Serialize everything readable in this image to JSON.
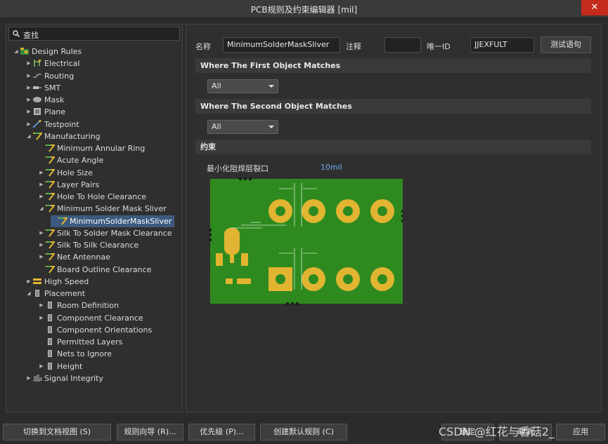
{
  "window": {
    "title": "PCB规则及约束编辑器 [mil]",
    "close_label": "✕"
  },
  "search": {
    "placeholder": "查找"
  },
  "tree": [
    {
      "label": "Design Rules",
      "icon": "design-rules-icon",
      "tw": "◢"
    },
    {
      "label": "Electrical",
      "icon": "electrical-icon",
      "tw": "▶"
    },
    {
      "label": "Routing",
      "icon": "routing-icon",
      "tw": "▶"
    },
    {
      "label": "SMT",
      "icon": "smt-icon",
      "tw": "▶"
    },
    {
      "label": "Mask",
      "icon": "mask-icon",
      "tw": "▶"
    },
    {
      "label": "Plane",
      "icon": "plane-icon",
      "tw": "▶"
    },
    {
      "label": "Testpoint",
      "icon": "testpoint-icon",
      "tw": "▶"
    },
    {
      "label": "Manufacturing",
      "icon": "manufacturing-icon",
      "tw": "◢"
    },
    {
      "label": "Minimum Annular Ring",
      "icon": "rule-icon",
      "tw": ""
    },
    {
      "label": "Acute Angle",
      "icon": "rule-icon",
      "tw": ""
    },
    {
      "label": "Hole Size",
      "icon": "rule-icon",
      "tw": "▶"
    },
    {
      "label": "Layer Pairs",
      "icon": "rule-icon",
      "tw": "▶"
    },
    {
      "label": "Hole To Hole Clearance",
      "icon": "rule-icon",
      "tw": "▶"
    },
    {
      "label": "Minimum Solder Mask Sliver",
      "icon": "rule-icon",
      "tw": "◢"
    },
    {
      "label": "MinimumSolderMaskSliver",
      "icon": "rule-icon",
      "tw": ""
    },
    {
      "label": "Silk To Solder Mask Clearance",
      "icon": "rule-icon",
      "tw": "▶"
    },
    {
      "label": "Silk To Silk Clearance",
      "icon": "rule-icon",
      "tw": "▶"
    },
    {
      "label": "Net Antennae",
      "icon": "rule-icon",
      "tw": "▶"
    },
    {
      "label": "Board Outline Clearance",
      "icon": "rule-icon",
      "tw": ""
    },
    {
      "label": "High Speed",
      "icon": "high-speed-icon",
      "tw": "▶"
    },
    {
      "label": "Placement",
      "icon": "placement-icon",
      "tw": "◢"
    },
    {
      "label": "Room Definition",
      "icon": "placement-rule-icon",
      "tw": "▶"
    },
    {
      "label": "Component Clearance",
      "icon": "placement-rule-icon",
      "tw": "▶"
    },
    {
      "label": "Component Orientations",
      "icon": "placement-rule-icon",
      "tw": ""
    },
    {
      "label": "Permitted Layers",
      "icon": "placement-rule-icon",
      "tw": ""
    },
    {
      "label": "Nets to Ignore",
      "icon": "placement-rule-icon",
      "tw": ""
    },
    {
      "label": "Height",
      "icon": "placement-rule-icon",
      "tw": "▶"
    },
    {
      "label": "Signal Integrity",
      "icon": "signal-integrity-icon",
      "tw": "▶"
    }
  ],
  "rule": {
    "name_label": "名称",
    "name_value": "MinimumSolderMaskSliver",
    "comment_label": "注释",
    "comment_value": "",
    "uid_label": "唯一ID",
    "uid_value": "JJEXFULT",
    "test_button": "测试语句"
  },
  "first_match": {
    "title": "Where The First Object Matches",
    "value": "All"
  },
  "second_match": {
    "title": "Where The Second Object Matches",
    "value": "All"
  },
  "constraints": {
    "title": "约束",
    "param_label": "最小化阻焊层裂口",
    "param_value": "10mil"
  },
  "bottom": {
    "doc_view": "切换到文档视图 (S)",
    "wizard": "规则向导 (R)...",
    "priority": "优先级 (P)...",
    "default_rules": "创建默认规则 (C)",
    "ok": "确定",
    "cancel": "取消",
    "apply": "应用"
  },
  "watermark": "CSDN @红花与香菇2_",
  "colors": {
    "board_green": "#2e8a1f",
    "pad_gold": "#e1b431",
    "selection": "#3c5a7d",
    "link_blue": "#6aaef0"
  }
}
